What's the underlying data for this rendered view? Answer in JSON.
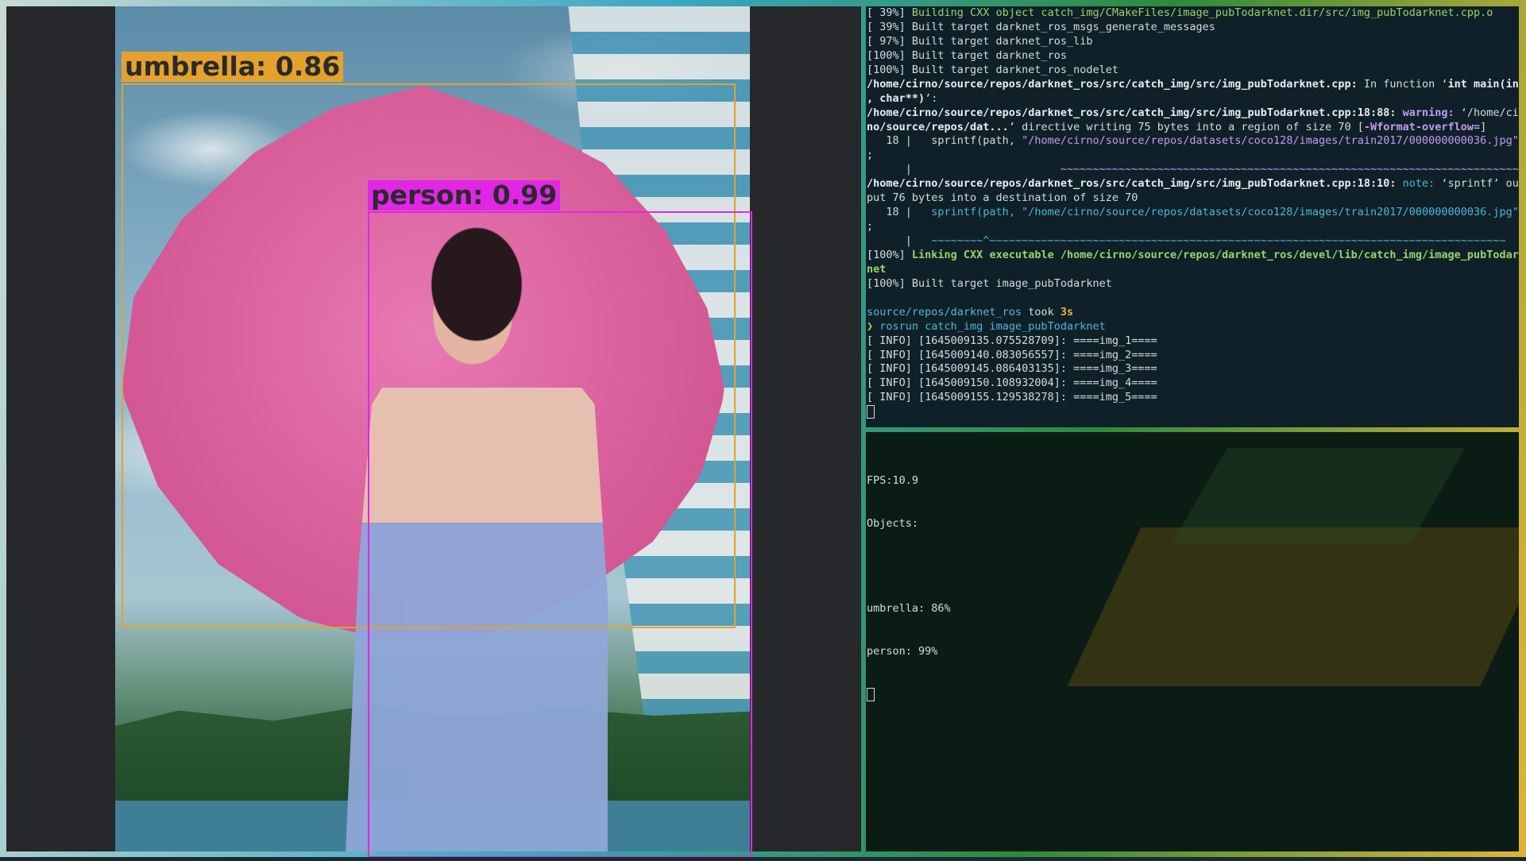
{
  "image_viewer": {
    "detections": [
      {
        "label": "umbrella: 0.86",
        "color": "#e5a12e"
      },
      {
        "label": "person: 0.99",
        "color": "#e226e6"
      }
    ]
  },
  "terminal_build": {
    "lines": [
      {
        "parts": [
          {
            "t": "[ 39%] ",
            "c": "dim"
          },
          {
            "t": "Building CXX object catch_img/CMakeFiles/image_pubTodarknet.dir/src/img_pubTodarknet.cpp.o",
            "c": "green"
          }
        ]
      },
      {
        "parts": [
          {
            "t": "[ 39%] Built target darknet_ros_msgs_generate_messages",
            "c": "dim"
          }
        ]
      },
      {
        "parts": [
          {
            "t": "[ 97%] Built target darknet_ros_lib",
            "c": "dim"
          }
        ]
      },
      {
        "parts": [
          {
            "t": "[100%] Built target darknet_ros",
            "c": "dim"
          }
        ]
      },
      {
        "parts": [
          {
            "t": "[100%] Built target darknet_ros_nodelet",
            "c": "dim"
          }
        ]
      },
      {
        "parts": [
          {
            "t": "/home/cirno/source/repos/darknet_ros/src/catch_img/src/img_pubTodarknet.cpp:",
            "c": "path"
          },
          {
            "t": " In function ‘",
            "c": "dim"
          },
          {
            "t": "int main(int",
            "c": "path"
          }
        ]
      },
      {
        "parts": [
          {
            "t": ", char**)",
            "c": "path"
          },
          {
            "t": "’:",
            "c": "dim"
          }
        ]
      },
      {
        "parts": [
          {
            "t": "/home/cirno/source/repos/darknet_ros/src/catch_img/src/img_pubTodarknet.cpp:18:88:",
            "c": "path"
          },
          {
            "t": " warning:",
            "c": "warn"
          },
          {
            "t": " ‘/home/cir",
            "c": "dim"
          }
        ]
      },
      {
        "parts": [
          {
            "t": "no/source/repos/dat...",
            "c": "path"
          },
          {
            "t": "’ directive writing 75 bytes into a region of size 70 [",
            "c": "dim"
          },
          {
            "t": "-Wformat-overflow=",
            "c": "warn"
          },
          {
            "t": "]",
            "c": "dim"
          }
        ]
      },
      {
        "parts": [
          {
            "t": "   18 |   sprintf(path, ",
            "c": "dim"
          },
          {
            "t": "\"/home/cirno/source/repos/datasets/coco128/images/train2017/000000000036.jpg\"",
            "c": "purple"
          },
          {
            "t": ")",
            "c": "dim"
          }
        ]
      },
      {
        "parts": [
          {
            "t": ";",
            "c": "dim"
          }
        ]
      },
      {
        "parts": [
          {
            "t": "      |                       ",
            "c": "dim"
          },
          {
            "t": "~~~~~~~~~~~~~~~~~~~~~~~~~~~~~~~~~~~~~~~~~~~~~~~~~~~~~~~~~~~~~~~~~~~~~~~~~~~^~~~",
            "c": "purple"
          }
        ]
      },
      {
        "parts": [
          {
            "t": "/home/cirno/source/repos/darknet_ros/src/catch_img/src/img_pubTodarknet.cpp:18:10:",
            "c": "path"
          },
          {
            "t": " note:",
            "c": "cyan"
          },
          {
            "t": " ‘sprintf’ out",
            "c": "dim"
          }
        ]
      },
      {
        "parts": [
          {
            "t": "put 76 bytes into a destination of size 70",
            "c": "dim"
          }
        ]
      },
      {
        "parts": [
          {
            "t": "   18 |   ",
            "c": "dim"
          },
          {
            "t": "sprintf(path, \"/home/cirno/source/repos/datasets/coco128/images/train2017/000000000036.jpg\"",
            "c": "cyan"
          }
        ]
      },
      {
        "parts": [
          {
            "t": ";",
            "c": "dim"
          }
        ]
      },
      {
        "parts": [
          {
            "t": "      |   ",
            "c": "dim"
          },
          {
            "t": "~~~~~~~~^~~~~~~~~~~~~~~~~~~~~~~~~~~~~~~~~~~~~~~~~~~~~~~~~~~~~~~~~~~~~~~~~~~~~~~~~~~~~~~~~",
            "c": "cyan"
          }
        ]
      },
      {
        "parts": [
          {
            "t": "[100%] ",
            "c": "dim"
          },
          {
            "t": "Linking CXX executable /home/cirno/source/repos/darknet_ros/devel/lib/catch_img/image_pubTodark",
            "c": "greenb"
          }
        ]
      },
      {
        "parts": [
          {
            "t": "net",
            "c": "greenb"
          }
        ]
      },
      {
        "parts": [
          {
            "t": "[100%] Built target image_pubTodarknet",
            "c": "dim"
          }
        ]
      },
      {
        "parts": [
          {
            "t": "",
            "c": "dim"
          }
        ]
      },
      {
        "parts": [
          {
            "t": "source/repos/darknet_ros",
            "c": "prompt-path"
          },
          {
            "t": " took ",
            "c": "dim"
          },
          {
            "t": "3s",
            "c": "yellow"
          }
        ]
      },
      {
        "parts": [
          {
            "t": "❯ ",
            "c": "prompt-arrow"
          },
          {
            "t": "rosrun catch_img image_pubTodarknet",
            "c": "cyan"
          }
        ]
      },
      {
        "parts": [
          {
            "t": "[ INFO] [1645009135.075528709]: ====img_1====",
            "c": "dim"
          }
        ]
      },
      {
        "parts": [
          {
            "t": "[ INFO] [1645009140.083056557]: ====img_2====",
            "c": "dim"
          }
        ]
      },
      {
        "parts": [
          {
            "t": "[ INFO] [1645009145.086403135]: ====img_3====",
            "c": "dim"
          }
        ]
      },
      {
        "parts": [
          {
            "t": "[ INFO] [1645009150.108932004]: ====img_4====",
            "c": "dim"
          }
        ]
      },
      {
        "parts": [
          {
            "t": "[ INFO] [1645009155.129538278]: ====img_5====",
            "c": "dim"
          }
        ]
      }
    ]
  },
  "terminal_output": {
    "fps": "FPS:10.9",
    "objects_label": "Objects:",
    "results": [
      "umbrella: 86%",
      "person: 99%"
    ]
  }
}
